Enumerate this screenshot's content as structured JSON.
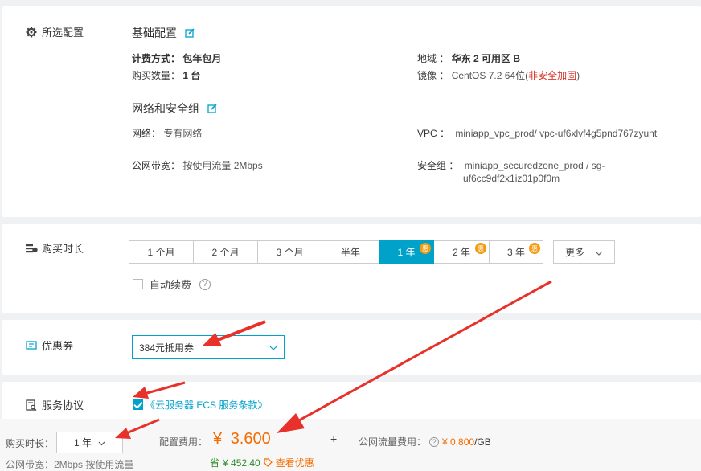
{
  "colors": {
    "accent": "#00a2ca",
    "price": "#f56c00",
    "arrow": "#e8312a",
    "badge": "#f39c12"
  },
  "config": {
    "title": "所选配置",
    "basic_title": "基础配置",
    "billing_label": "计费方式：",
    "billing_value": "包年包月",
    "qty_label": "购买数量：",
    "qty_value": "1 台",
    "region_label": "地域 ：",
    "region_value": "华东 2 可用区 B",
    "image_label": "镜像 ：",
    "image_value": "CentOS 7.2 64位",
    "image_paren_open": "(",
    "image_warning": "非安全加固",
    "image_paren_close": ")",
    "net_title": "网络和安全组",
    "network_label": "网络：",
    "network_value": "专有网络",
    "vpc_label": "VPC ：",
    "vpc_value": "miniapp_vpc_prod/ vpc-uf6xlvf4g5pnd767zyunt",
    "bandwidth_label": "公网带宽：",
    "bandwidth_value": "按使用流量 2Mbps",
    "sg_label": "安全组 ：",
    "sg_value_line1": "miniapp_securedzone_prod / sg-",
    "sg_value_line2": "uf6cc9df2x1iz01p0f0m"
  },
  "duration": {
    "title": "购买时长",
    "options": [
      {
        "label": "1 个月"
      },
      {
        "label": "2 个月"
      },
      {
        "label": "3 个月"
      },
      {
        "label": "半年"
      },
      {
        "label": "1 年",
        "badge": "惠",
        "selected": true
      },
      {
        "label": "2 年",
        "badge": "惠"
      },
      {
        "label": "3 年",
        "badge": "惠"
      }
    ],
    "more_label": "更多",
    "auto_renew_label": "自动续费",
    "help_glyph": "?"
  },
  "coupon": {
    "title": "优惠券",
    "selected": "384元抵用券"
  },
  "agreement": {
    "title": "服务协议",
    "checked": true,
    "link_text": "《云服务器 ECS 服务条款》"
  },
  "footer": {
    "duration_label": "购买时长：",
    "duration_value": "1 年",
    "config_fee_label": "配置费用：",
    "currency": "¥",
    "config_fee_value": "3.600",
    "plus": "+",
    "traffic_label": "公网流量费用：",
    "traffic_help": "?",
    "traffic_price": "¥ 0.800",
    "traffic_unit": " /GB",
    "save_prefix": "省",
    "save_amount": "¥ 452.40",
    "view_discount": "查看优惠",
    "bandwidth_note": "公网带宽：2Mbps 按使用流量"
  }
}
